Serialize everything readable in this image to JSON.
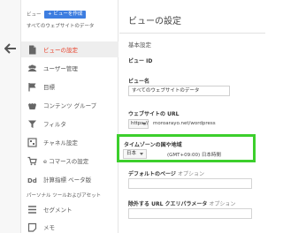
{
  "sidebar": {
    "view_heading": "ビュー",
    "create_view_label": "+ ビューを作成",
    "current_view": "すべてのウェブサイトのデータ",
    "items": [
      {
        "label": "ビューの設定",
        "icon": "document-icon",
        "active": true
      },
      {
        "label": "ユーザー管理",
        "icon": "users-icon",
        "active": false
      },
      {
        "label": "目標",
        "icon": "flag-icon",
        "active": false
      },
      {
        "label": "コンテンツ グループ",
        "icon": "content-group-icon",
        "active": false
      },
      {
        "label": "フィルタ",
        "icon": "filter-icon",
        "active": false
      },
      {
        "label": "チャネル設定",
        "icon": "channel-icon",
        "active": false
      },
      {
        "label": "e コマースの設定",
        "icon": "cart-icon",
        "active": false
      },
      {
        "label": "計算指標 ベータ版",
        "icon": "calculated-metrics-icon",
        "active": false
      }
    ],
    "section_label": "パーソナル ツールおよびアセット",
    "tool_items": [
      {
        "label": "セグメント",
        "icon": "segments-icon"
      },
      {
        "label": "メモ",
        "icon": "notes-icon"
      }
    ]
  },
  "main": {
    "title": "ビューの設定",
    "section_heading": "基本設定",
    "view_id_label": "ビュー ID",
    "view_name_label": "ビュー名",
    "view_name_value": "すべてのウェブサイトのデータ",
    "website_url_label": "ウェブサイトの URL",
    "url_protocol": "https://",
    "url_value": "moroarayo.net/wordpress",
    "timezone_label": "タイムゾーンの国や地域",
    "timezone_country": "日本",
    "timezone_value": "(GMT+09:00) 日本時間",
    "default_page_label": "デフォルトのページ",
    "default_page_optional": "オプション",
    "exclude_params_label": "除外する URL クエリパラメータ",
    "exclude_params_optional": "オプション"
  },
  "colors": {
    "accent_blue": "#3d7de0",
    "active_red": "#e8422c",
    "highlight_green": "#3ccf2c"
  }
}
